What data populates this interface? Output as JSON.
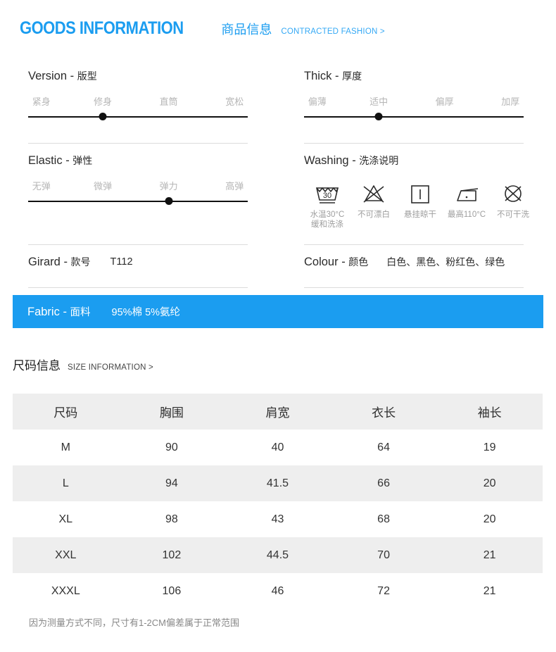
{
  "header": {
    "title_en": "GOODS INFORMATION",
    "title_cn": "商品信息",
    "subtitle": "CONTRACTED FASHION >",
    "accent_color": "#1b9df0"
  },
  "specs": [
    {
      "key": "version",
      "label_en": "Version",
      "dash": "-",
      "label_cn": "版型",
      "options": [
        "紧身",
        "修身",
        "直筒",
        "宽松"
      ],
      "selected_index": 1
    },
    {
      "key": "thick",
      "label_en": "Thick",
      "dash": "-",
      "label_cn": "厚度",
      "options": [
        "偏薄",
        "适中",
        "偏厚",
        "加厚"
      ],
      "selected_index": 1
    },
    {
      "key": "elastic",
      "label_en": "Elastic",
      "dash": "-",
      "label_cn": "弹性",
      "options": [
        "无弹",
        "微弹",
        "弹力",
        "高弹"
      ],
      "selected_index": 2
    }
  ],
  "washing": {
    "label_en": "Washing",
    "dash": "-",
    "label_cn": "洗涤说明",
    "items": [
      {
        "icon": "wash-tub-30-gentle-icon",
        "caption": "水温30°C\n缓和洗涤"
      },
      {
        "icon": "no-bleach-icon",
        "caption": "不可漂白"
      },
      {
        "icon": "line-dry-hang-icon",
        "caption": "悬挂晾干"
      },
      {
        "icon": "iron-low-110-icon",
        "caption": "最高110°C"
      },
      {
        "icon": "no-dry-clean-icon",
        "caption": "不可干洗"
      }
    ]
  },
  "girard": {
    "label_en": "Girard",
    "dash": "-",
    "label_cn": "款号",
    "value": "T112"
  },
  "colour": {
    "label_en": "Colour",
    "dash": "-",
    "label_cn": "颜色",
    "value": "白色、黑色、粉红色、绿色"
  },
  "fabric": {
    "label_en": "Fabric",
    "dash": "-",
    "label_cn": "面料",
    "value": "95%棉 5%氨纶",
    "background_color": "#1b9df0"
  },
  "size_section": {
    "title_cn": "尺码信息",
    "title_en": "SIZE INFORMATION >",
    "note": "因为测量方式不同，尺寸有1-2CM偏差属于正常范围"
  },
  "size_table": {
    "columns": [
      "尺码",
      "胸围",
      "肩宽",
      "衣长",
      "袖长"
    ],
    "rows": [
      [
        "M",
        "90",
        "40",
        "64",
        "19"
      ],
      [
        "L",
        "94",
        "41.5",
        "66",
        "20"
      ],
      [
        "XL",
        "98",
        "43",
        "68",
        "20"
      ],
      [
        "XXL",
        "102",
        "44.5",
        "70",
        "21"
      ],
      [
        "XXXL",
        "106",
        "46",
        "72",
        "21"
      ]
    ]
  }
}
